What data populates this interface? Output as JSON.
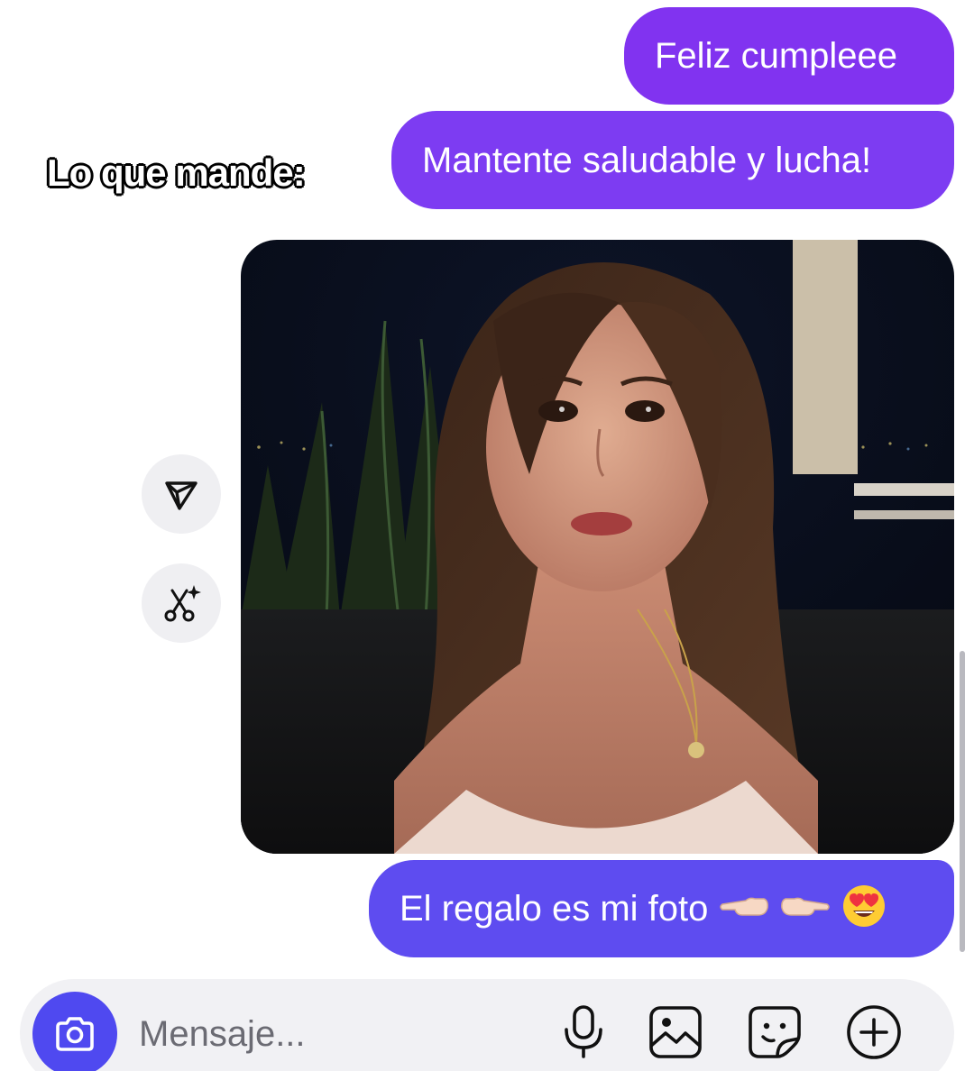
{
  "messages": [
    {
      "text": "Feliz cumpleee"
    },
    {
      "text": "Mantente saludable y lucha!"
    },
    {
      "text": "El regalo es mi foto",
      "emojis": [
        "backhand-index-pointing-left",
        "backhand-index-pointing-right",
        "smiling-face-with-heart-eyes"
      ]
    }
  ],
  "overlay_caption": "Lo que mande:",
  "photo": {
    "icon": "selfie-photo",
    "description_icon": "photo-message"
  },
  "side_actions": [
    {
      "icon": "send-icon"
    },
    {
      "icon": "ai-scissors-icon"
    }
  ],
  "composer": {
    "placeholder": "Mensaje...",
    "icons": [
      "camera-icon",
      "microphone-icon",
      "gallery-icon",
      "sticker-icon",
      "plus-icon"
    ]
  },
  "colors": {
    "bubble_1": "#8133f0",
    "bubble_2": "#7d3cf2",
    "bubble_3": "#5e4cf0",
    "camera_button": "#4f49f0",
    "composer_bg": "#f1f1f4"
  }
}
